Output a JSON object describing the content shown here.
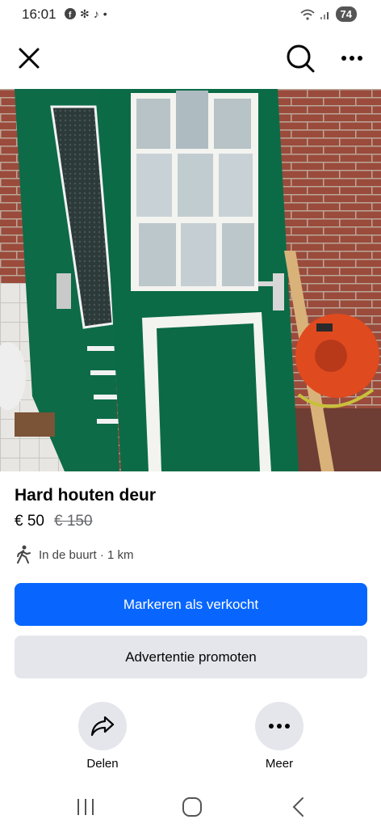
{
  "status_bar": {
    "time": "16:01",
    "battery": "74",
    "notification_icons": [
      "facebook-icon",
      "pinwheel-icon",
      "tiktok-icon",
      "more-dot-icon"
    ]
  },
  "listing": {
    "title": "Hard houten deur",
    "price": "€ 50",
    "original_price": "€ 150",
    "location": "In de buurt · 1 km",
    "image_count": 2,
    "current_image": 1
  },
  "buttons": {
    "mark_sold": "Markeren als verkocht",
    "promote": "Advertentie promoten"
  },
  "actions": {
    "share_label": "Delen",
    "more_label": "Meer"
  },
  "colors": {
    "primary": "#0866ff",
    "secondary_bg": "#e4e6eb",
    "door_green": "#0b6b47"
  }
}
